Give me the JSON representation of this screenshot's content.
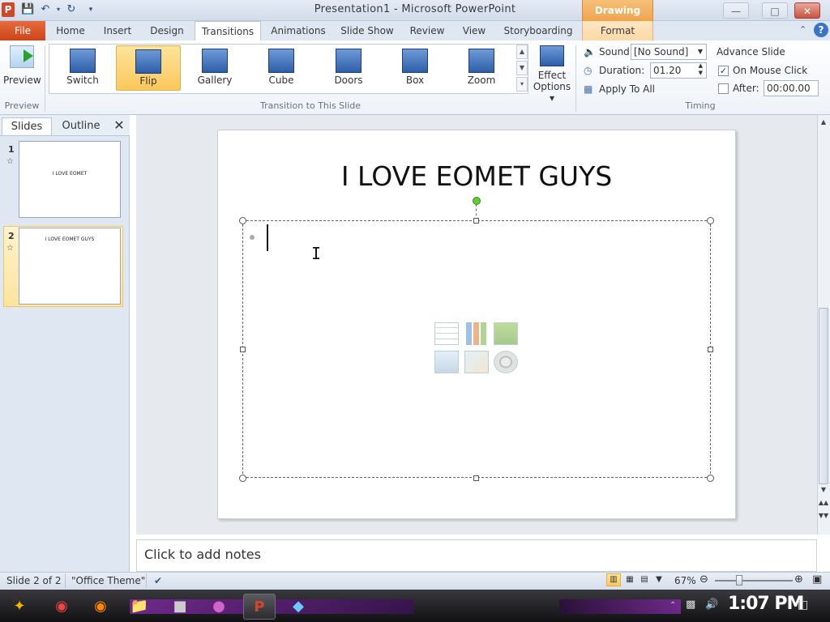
{
  "window": {
    "title": "Presentation1 - Microsoft PowerPoint",
    "contextual_header": "Drawing Tools",
    "app_icon_letter": "P"
  },
  "tabs": {
    "file": "File",
    "items": [
      "Home",
      "Insert",
      "Design",
      "Transitions",
      "Animations",
      "Slide Show",
      "Review",
      "View",
      "Storyboarding",
      "Format"
    ],
    "active": "Transitions"
  },
  "ribbon": {
    "preview_label": "Preview",
    "preview_group": "Preview",
    "transitions": [
      "Switch",
      "Flip",
      "Gallery",
      "Cube",
      "Doors",
      "Box",
      "Zoom"
    ],
    "selected_transition": "Flip",
    "effect_options_line1": "Effect",
    "effect_options_line2": "Options",
    "transition_group": "Transition to This Slide",
    "sound_label": "Sound:",
    "sound_value": "[No Sound]",
    "duration_label": "Duration:",
    "duration_value": "01.20",
    "apply_all": "Apply To All",
    "advance_slide": "Advance Slide",
    "on_mouse_click": "On Mouse Click",
    "on_mouse_click_checked": true,
    "after_label": "After:",
    "after_value": "00:00.00",
    "after_checked": false,
    "timing_group": "Timing"
  },
  "left_pane": {
    "tab_slides": "Slides",
    "tab_outline": "Outline",
    "close": "✕",
    "slides": [
      {
        "number": "1",
        "text": "I LOVE EOMET"
      },
      {
        "number": "2",
        "text": "I LOVE EOMET GUYS"
      }
    ]
  },
  "slide": {
    "title": "I LOVE EOMET GUYS"
  },
  "notes": {
    "placeholder": "Click to add notes"
  },
  "status": {
    "slide_info": "Slide 2 of 2",
    "theme": "\"Office Theme\"",
    "zoom": "67%",
    "zoom_level_fraction": 0.67
  },
  "taskbar": {
    "clock": "1:07 PM"
  },
  "colors": {
    "file_tab": "#cc4519",
    "contextual": "#f0a34c",
    "selection": "#fbc85b"
  }
}
